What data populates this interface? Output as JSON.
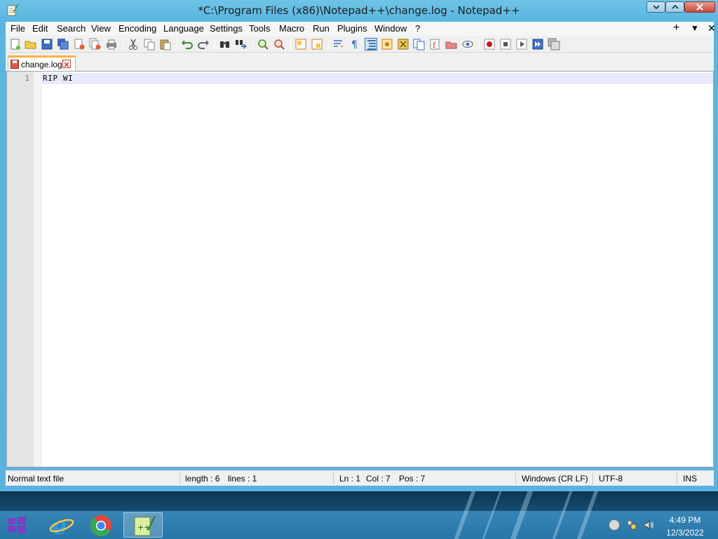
{
  "window": {
    "title": "*C:\\Program Files (x86)\\Notepad++\\change.log - Notepad++"
  },
  "menu": {
    "items": [
      "File",
      "Edit",
      "Search",
      "View",
      "Encoding",
      "Language",
      "Settings",
      "Tools",
      "Macro",
      "Run",
      "Plugins",
      "Window",
      "?"
    ],
    "right_plus": "+",
    "right_down": "▼",
    "right_close": "✕"
  },
  "toolbar": {
    "icons": [
      "new-file-icon",
      "open-file-icon",
      "save-icon",
      "save-all-icon",
      "close-icon",
      "close-all-icon",
      "print-icon",
      "cut-icon",
      "copy-icon",
      "paste-icon",
      "undo-icon",
      "redo-icon",
      "find-icon",
      "replace-icon",
      "zoom-in-icon",
      "zoom-out-icon",
      "sync-vertical-icon",
      "sync-horizontal-icon",
      "word-wrap-icon",
      "show-all-chars-icon",
      "indent-guide-icon",
      "udl-icon",
      "doc-map-icon",
      "doc-list-icon",
      "function-list-icon",
      "folder-workspace-icon",
      "monitoring-icon",
      "record-macro-icon",
      "stop-macro-icon",
      "play-macro-icon",
      "run-macro-multiple-icon",
      "save-macro-icon"
    ]
  },
  "tab": {
    "label": "change.log"
  },
  "editor": {
    "line_number": "1",
    "line_text": "RIP WI"
  },
  "status": {
    "file_type": "Normal text file",
    "length": "length : 6",
    "lines": "lines : 1",
    "ln": "Ln : 1",
    "col": "Col : 7",
    "pos": "Pos : 7",
    "eol": "Windows (CR LF)",
    "encoding": "UTF-8",
    "mode": "INS"
  },
  "taskbar": {
    "time": "4:49 PM",
    "date": "12/3/2022"
  },
  "colors": {
    "title_bar": "#5ab5e0",
    "current_line": "#e8e8ff",
    "tab_accent": "#fab34b",
    "taskbar": "#1e6a9a"
  }
}
